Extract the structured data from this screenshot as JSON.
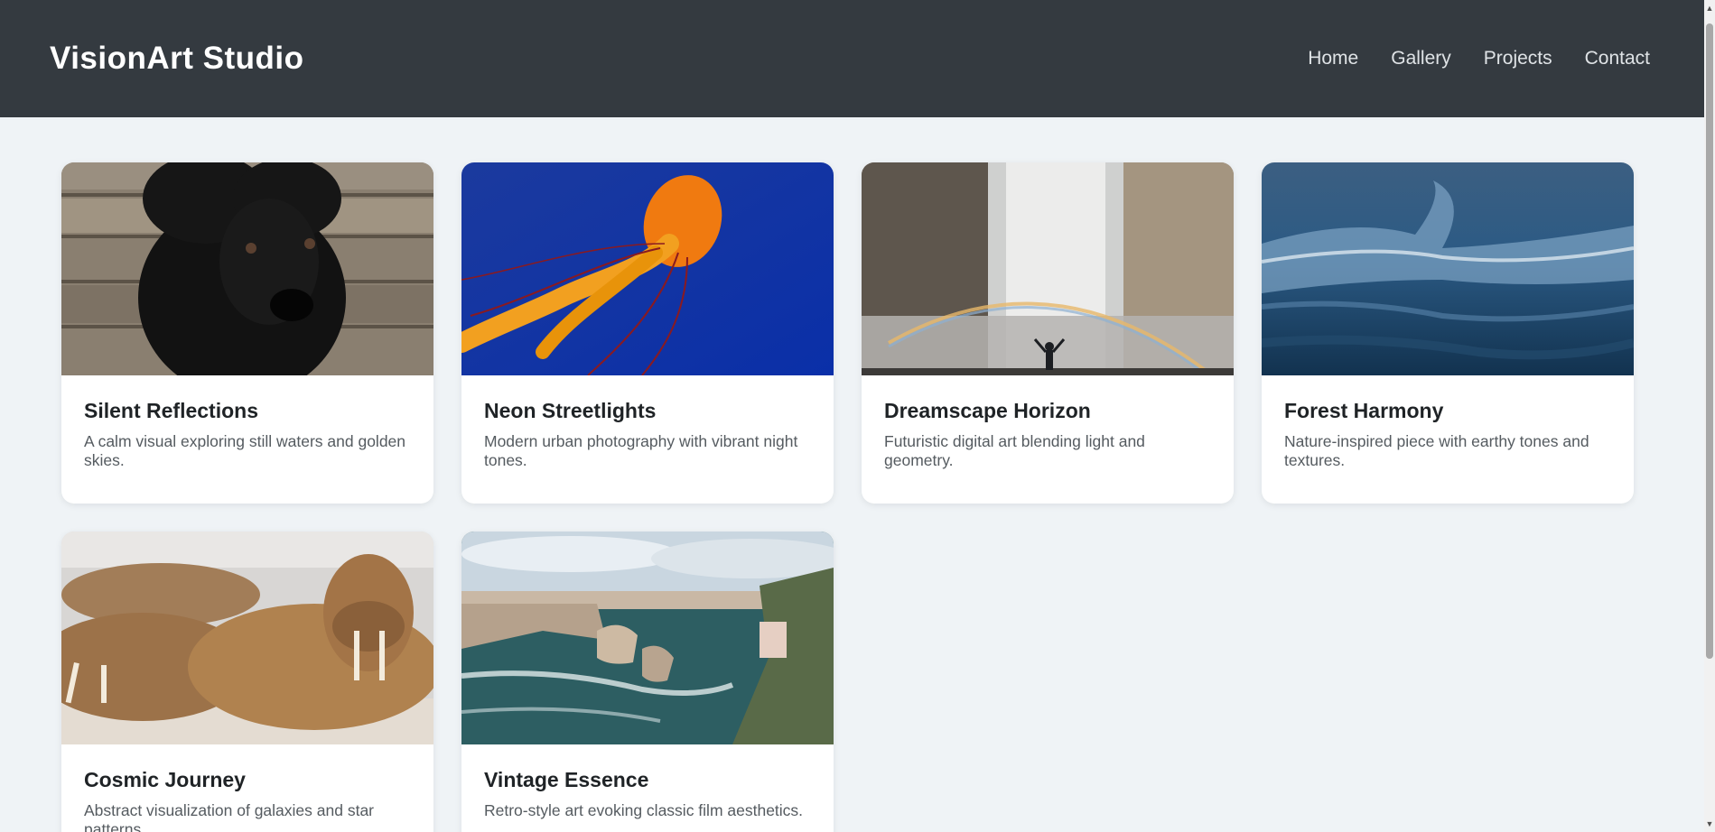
{
  "header": {
    "brand": "VisionArt Studio",
    "nav": [
      {
        "label": "Home"
      },
      {
        "label": "Gallery"
      },
      {
        "label": "Projects"
      },
      {
        "label": "Contact"
      }
    ]
  },
  "cards": [
    {
      "title": "Silent Reflections",
      "desc": "A calm visual exploring still waters and golden skies.",
      "image": "black-puppy-photo"
    },
    {
      "title": "Neon Streetlights",
      "desc": "Modern urban photography with vibrant night tones.",
      "image": "orange-jellyfish-photo"
    },
    {
      "title": "Dreamscape Horizon",
      "desc": "Futuristic digital art blending light and geometry.",
      "image": "waterfall-rainbow-photo"
    },
    {
      "title": "Forest Harmony",
      "desc": "Nature-inspired piece with earthy tones and textures.",
      "image": "ocean-wave-photo"
    },
    {
      "title": "Cosmic Journey",
      "desc": "Abstract visualization of galaxies and star patterns.",
      "image": "walrus-photo"
    },
    {
      "title": "Vintage Essence",
      "desc": "Retro-style art evoking classic film aesthetics.",
      "image": "coastal-cliffs-photo"
    }
  ],
  "colors": {
    "header_bg": "#343a40",
    "page_bg": "#eff3f6",
    "card_bg": "#ffffff"
  }
}
